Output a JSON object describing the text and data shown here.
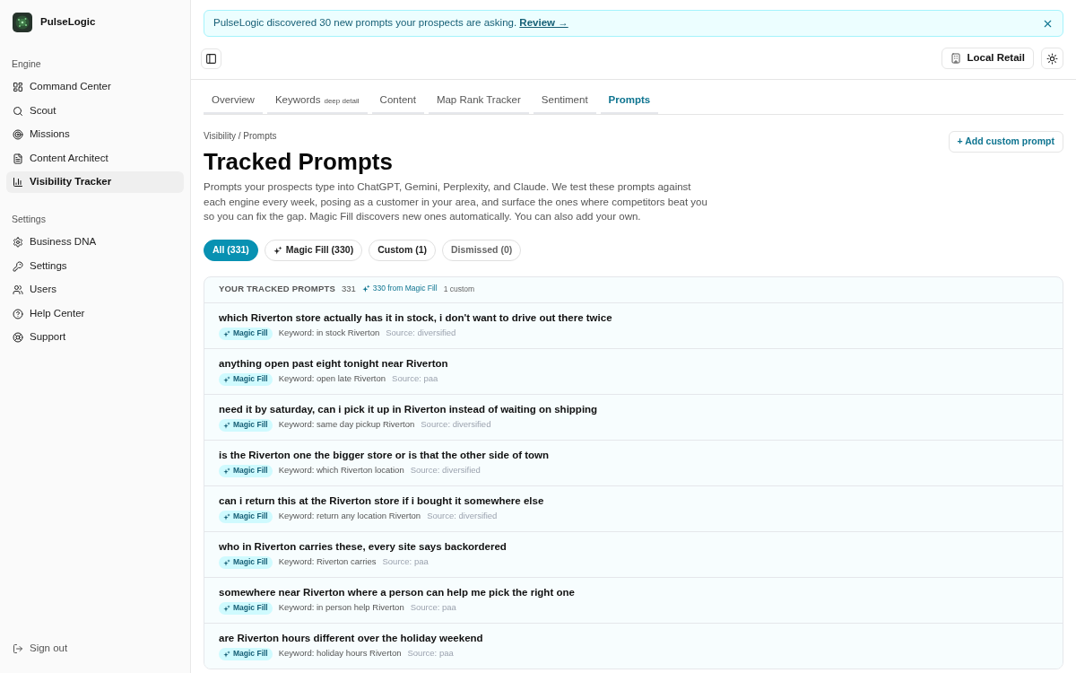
{
  "app": {
    "name": "PulseLogic"
  },
  "sidebar": {
    "sections": [
      {
        "label": "Engine",
        "items": [
          {
            "label": "Command Center",
            "selected": false
          },
          {
            "label": "Scout",
            "selected": false
          },
          {
            "label": "Missions",
            "selected": false
          },
          {
            "label": "Content Architect",
            "selected": false
          },
          {
            "label": "Visibility Tracker",
            "selected": true
          }
        ]
      },
      {
        "label": "Settings",
        "items": [
          {
            "label": "Business DNA",
            "selected": false
          },
          {
            "label": "Settings",
            "selected": false
          },
          {
            "label": "Users",
            "selected": false
          },
          {
            "label": "Help Center",
            "selected": false
          },
          {
            "label": "Support",
            "selected": false
          }
        ]
      }
    ],
    "footer": {
      "label": "Sign out"
    }
  },
  "banner": {
    "text": "PulseLogic discovered 30 new prompts your prospects are asking.",
    "link": "Review →"
  },
  "toolbar": {
    "workspace": "Local Retail"
  },
  "tabs": [
    {
      "label": "Overview",
      "selected": false
    },
    {
      "label": "Keywords",
      "note": "deep detail",
      "selected": false
    },
    {
      "label": "Content",
      "selected": false
    },
    {
      "label": "Map Rank Tracker",
      "selected": false
    },
    {
      "label": "Sentiment",
      "selected": false
    },
    {
      "label": "Prompts",
      "selected": true
    }
  ],
  "page": {
    "breadcrumb": "Visibility / Prompts",
    "title": "Tracked Prompts",
    "description": "Prompts your prospects type into ChatGPT, Gemini, Perplexity, and Claude. We test these prompts against each engine every week, posing as a customer in your area, and surface the ones where competitors beat you so you can fix the gap. Magic Fill discovers new ones automatically. You can also add your own.",
    "action": "+ Add custom prompt"
  },
  "filters": [
    {
      "label": "All (331)",
      "kind": "plain",
      "selected": true,
      "dimmed": false
    },
    {
      "label": "Magic Fill (330)",
      "kind": "sparkle",
      "selected": false,
      "dimmed": false
    },
    {
      "label": "Custom (1)",
      "kind": "plain",
      "selected": false,
      "dimmed": false
    },
    {
      "label": "Dismissed (0)",
      "kind": "plain",
      "selected": false,
      "dimmed": true
    }
  ],
  "list": {
    "heading": "YOUR TRACKED PROMPTS",
    "count": "331",
    "magic_fill_count": "330 from Magic Fill",
    "custom_count": "1 custom",
    "rows": [
      {
        "prompt": "which Riverton store actually has it in stock, i don't want to drive out there twice",
        "badge": "Magic Fill",
        "keyword": "Keyword: in stock Riverton",
        "source": "Source: diversified"
      },
      {
        "prompt": "anything open past eight tonight near Riverton",
        "badge": "Magic Fill",
        "keyword": "Keyword: open late Riverton",
        "source": "Source: paa"
      },
      {
        "prompt": "need it by saturday, can i pick it up in Riverton instead of waiting on shipping",
        "badge": "Magic Fill",
        "keyword": "Keyword: same day pickup Riverton",
        "source": "Source: diversified"
      },
      {
        "prompt": "is the Riverton one the bigger store or is that the other side of town",
        "badge": "Magic Fill",
        "keyword": "Keyword: which Riverton location",
        "source": "Source: diversified"
      },
      {
        "prompt": "can i return this at the Riverton store if i bought it somewhere else",
        "badge": "Magic Fill",
        "keyword": "Keyword: return any location Riverton",
        "source": "Source: diversified"
      },
      {
        "prompt": "who in Riverton carries these, every site says backordered",
        "badge": "Magic Fill",
        "keyword": "Keyword: Riverton carries",
        "source": "Source: paa"
      },
      {
        "prompt": "somewhere near Riverton where a person can help me pick the right one",
        "badge": "Magic Fill",
        "keyword": "Keyword: in person help Riverton",
        "source": "Source: paa"
      },
      {
        "prompt": "are Riverton hours different over the holiday weekend",
        "badge": "Magic Fill",
        "keyword": "Keyword: holiday hours Riverton",
        "source": "Source: paa"
      }
    ]
  }
}
